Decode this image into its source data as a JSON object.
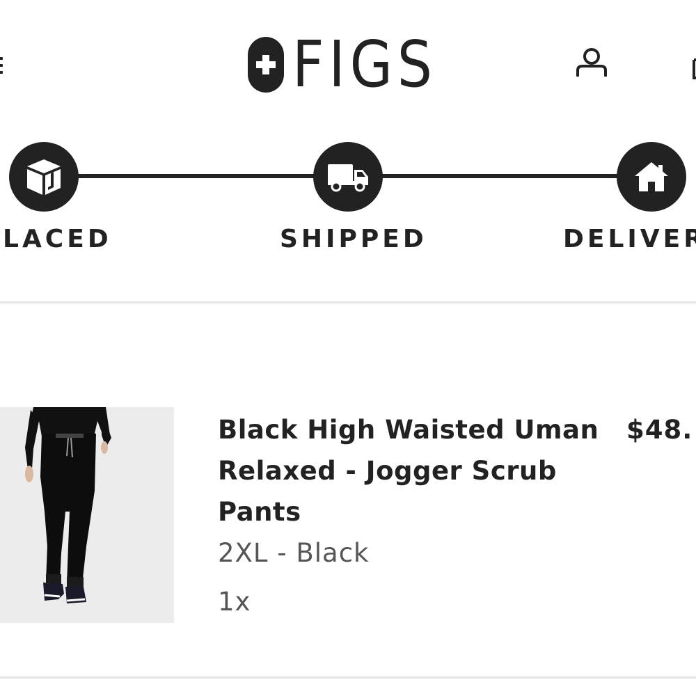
{
  "header": {
    "brand": "FIGS",
    "icons": {
      "menu": "hamburger-menu-icon",
      "logo_mark": "plus-icon",
      "account": "user-account-icon",
      "cart": "shopping-bag-icon"
    }
  },
  "tracker": {
    "steps": [
      {
        "label": "LACED",
        "icon": "package-box-icon"
      },
      {
        "label": "SHIPPED",
        "icon": "delivery-truck-icon"
      },
      {
        "label": "DELIVER",
        "icon": "house-icon"
      }
    ],
    "colors": {
      "active": "#222222",
      "icon_fill": "#ffffff"
    }
  },
  "order_item": {
    "name": "Black High Waisted Uman Relaxed - Jogger Scrub Pants",
    "price": "$48.",
    "variant": "2XL - Black",
    "quantity": "1x",
    "image": "black-jogger-scrub-pants-photo"
  },
  "colors": {
    "text_primary": "#222222",
    "text_secondary": "#555555",
    "divider": "#e6e6e6",
    "image_bg": "#ececec"
  }
}
